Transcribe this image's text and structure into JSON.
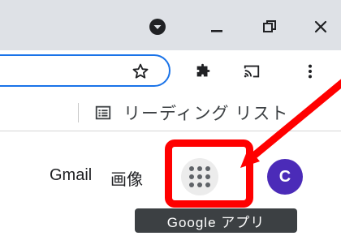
{
  "window_controls": {
    "profile_icon": "profile-dropdown-icon",
    "minimize_icon": "minimize-icon",
    "restore_icon": "restore-icon",
    "close_icon": "close-icon"
  },
  "toolbar": {
    "bookmark_icon": "star-icon",
    "extensions_icon": "puzzle-icon",
    "cast_icon": "cast-icon",
    "menu_icon": "kebab-menu-icon"
  },
  "bookmarks_bar": {
    "reading_list_icon": "reading-list-icon",
    "reading_list_label": "リーディング リスト"
  },
  "header": {
    "gmail_label": "Gmail",
    "images_label": "画像",
    "apps_icon": "apps-grid-icon",
    "avatar_letter": "C",
    "apps_tooltip": "Google アプリ"
  },
  "colors": {
    "highlight": "#ff0000",
    "avatar": "#4b2bb8",
    "focus_ring": "#1a73e8",
    "titlebar": "#dee1e6",
    "tooltip": "#3c4043"
  }
}
